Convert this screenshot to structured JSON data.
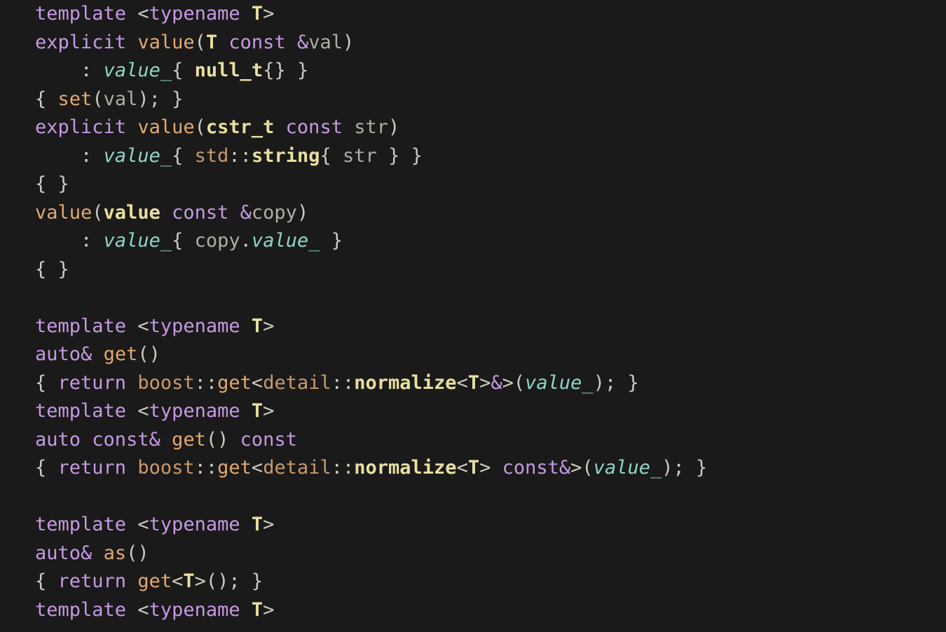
{
  "tokens": {
    "template": "template",
    "typename": "typename",
    "T": "T",
    "explicit": "explicit",
    "value": "value",
    "const": "const",
    "val": "val",
    "value_": "value_",
    "null_t": "null_t",
    "set": "set",
    "cstr_t": "cstr_t",
    "str": "str",
    "std": "std",
    "string": "string",
    "copy": "copy",
    "auto": "auto",
    "get": "get",
    "return": "return",
    "boost": "boost",
    "detail": "detail",
    "normalize": "normalize",
    "as": "as"
  }
}
